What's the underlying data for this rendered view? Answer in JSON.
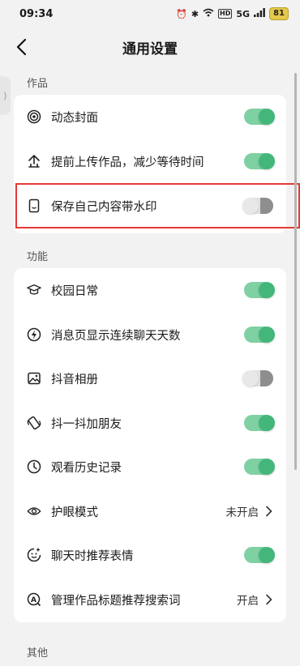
{
  "status_bar": {
    "time": "09:34",
    "network": "5G",
    "battery": "81"
  },
  "header": {
    "title": "通用设置"
  },
  "sections": [
    {
      "label": "作品",
      "items": [
        {
          "label": "动态封面",
          "icon": "live-cover-icon",
          "toggle": true
        },
        {
          "label": "提前上传作品，减少等待时间",
          "icon": "upload-icon",
          "toggle": true
        },
        {
          "label": "保存自己内容带水印",
          "icon": "phone-watermark-icon",
          "toggle": false
        }
      ]
    },
    {
      "label": "功能",
      "items": [
        {
          "label": "校园日常",
          "icon": "graduation-cap-icon",
          "toggle": true
        },
        {
          "label": "消息页显示连续聊天天数",
          "icon": "lightning-icon",
          "toggle": true
        },
        {
          "label": "抖音相册",
          "icon": "photo-album-icon",
          "toggle": false
        },
        {
          "label": "抖一抖加朋友",
          "icon": "shake-phone-icon",
          "toggle": true
        },
        {
          "label": "观看历史记录",
          "icon": "clock-icon",
          "toggle": true
        },
        {
          "label": "护眼模式",
          "icon": "eye-icon",
          "value": "未开启"
        },
        {
          "label": "聊天时推荐表情",
          "icon": "emoji-icon",
          "toggle": true
        },
        {
          "label": "管理作品标题推荐搜索词",
          "icon": "search-word-icon",
          "value": "开启"
        }
      ]
    },
    {
      "label": "其他"
    }
  ],
  "colors": {
    "toggle_on": "#43b77a",
    "highlight": "#e53935"
  }
}
